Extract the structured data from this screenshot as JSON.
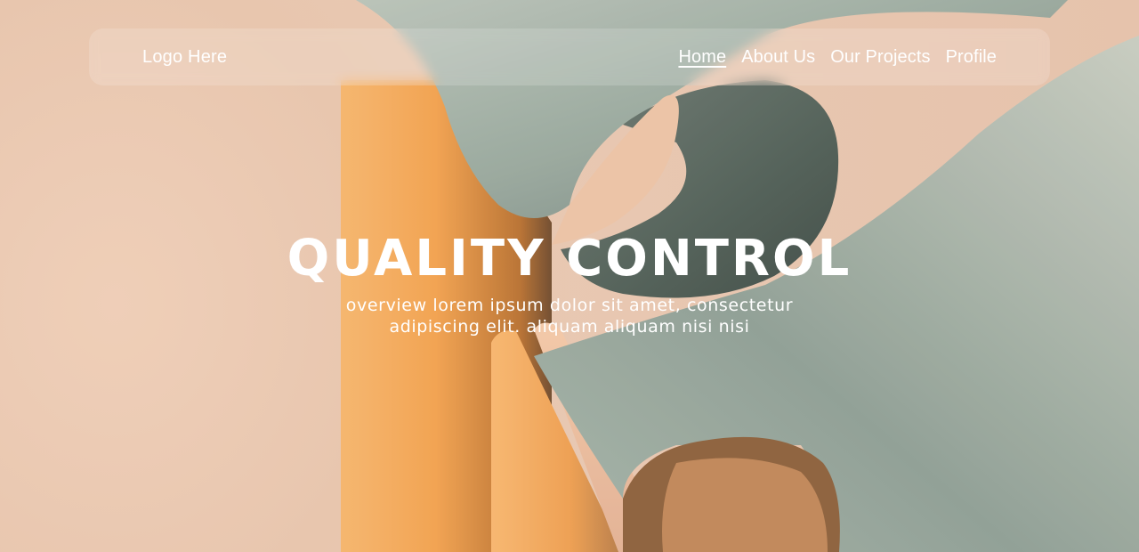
{
  "header": {
    "logo": "Logo Here",
    "nav": [
      {
        "label": "Home",
        "active": true
      },
      {
        "label": "About Us",
        "active": false
      },
      {
        "label": "Our Projects",
        "active": false
      },
      {
        "label": "Profile",
        "active": false
      }
    ]
  },
  "hero": {
    "title": "QUALITY CONTROL",
    "subtitle": "overview lorem ipsum dolor sit amet, consectetur adipiscing elit. aliquam aliquam nisi nisi"
  },
  "colors": {
    "background": "#e9c9b3",
    "orange": "#f2a24e",
    "sage": "#9fada2",
    "text": "#ffffff"
  }
}
